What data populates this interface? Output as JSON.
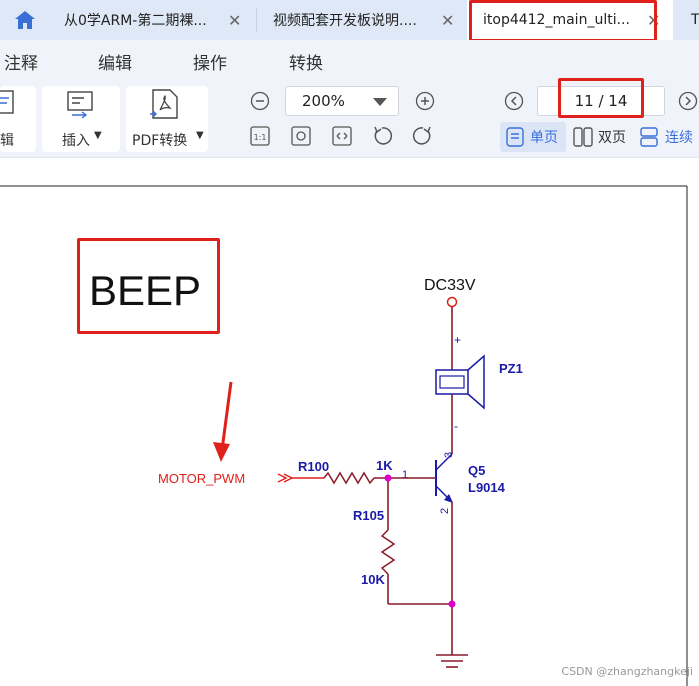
{
  "tabs": [
    {
      "label": "从0学ARM-第二期裸...",
      "close": "✕"
    },
    {
      "label": "视频配套开发板说明....",
      "close": "✕"
    },
    {
      "label": "itop4412_main_ulti...",
      "close": "✕"
    },
    {
      "label": "T"
    }
  ],
  "menu": [
    "注释",
    "编辑",
    "操作",
    "转换"
  ],
  "toolbar": {
    "left_label": "辑",
    "insert_label": "插入",
    "pdf_label": "PDF转换",
    "zoom_value": "200%",
    "page_value": "11 / 14",
    "view_single": "单页",
    "view_double": "双页",
    "view_continuous": "连续"
  },
  "document": {
    "beep_title": "BEEP",
    "power_label": "DC33V",
    "buzzer_label": "PZ1",
    "signal_label": "MOTOR_PWM",
    "resistor1_label": "R100",
    "resistor1_value": "1K",
    "resistor2_label": "R105",
    "resistor2_value": "10K",
    "transistor_label": "Q5",
    "transistor_model": "L9014",
    "pin1": "1",
    "pin2": "2",
    "pin3": "3",
    "plus": "+",
    "minus": "-"
  },
  "watermark": "CSDN @zhangzhangkeji",
  "colors": {
    "highlight": "#e0201a",
    "wire": "#8b1a2a",
    "component": "#1a1aa8",
    "signal": "#e0201a",
    "node": "#e000c8"
  }
}
